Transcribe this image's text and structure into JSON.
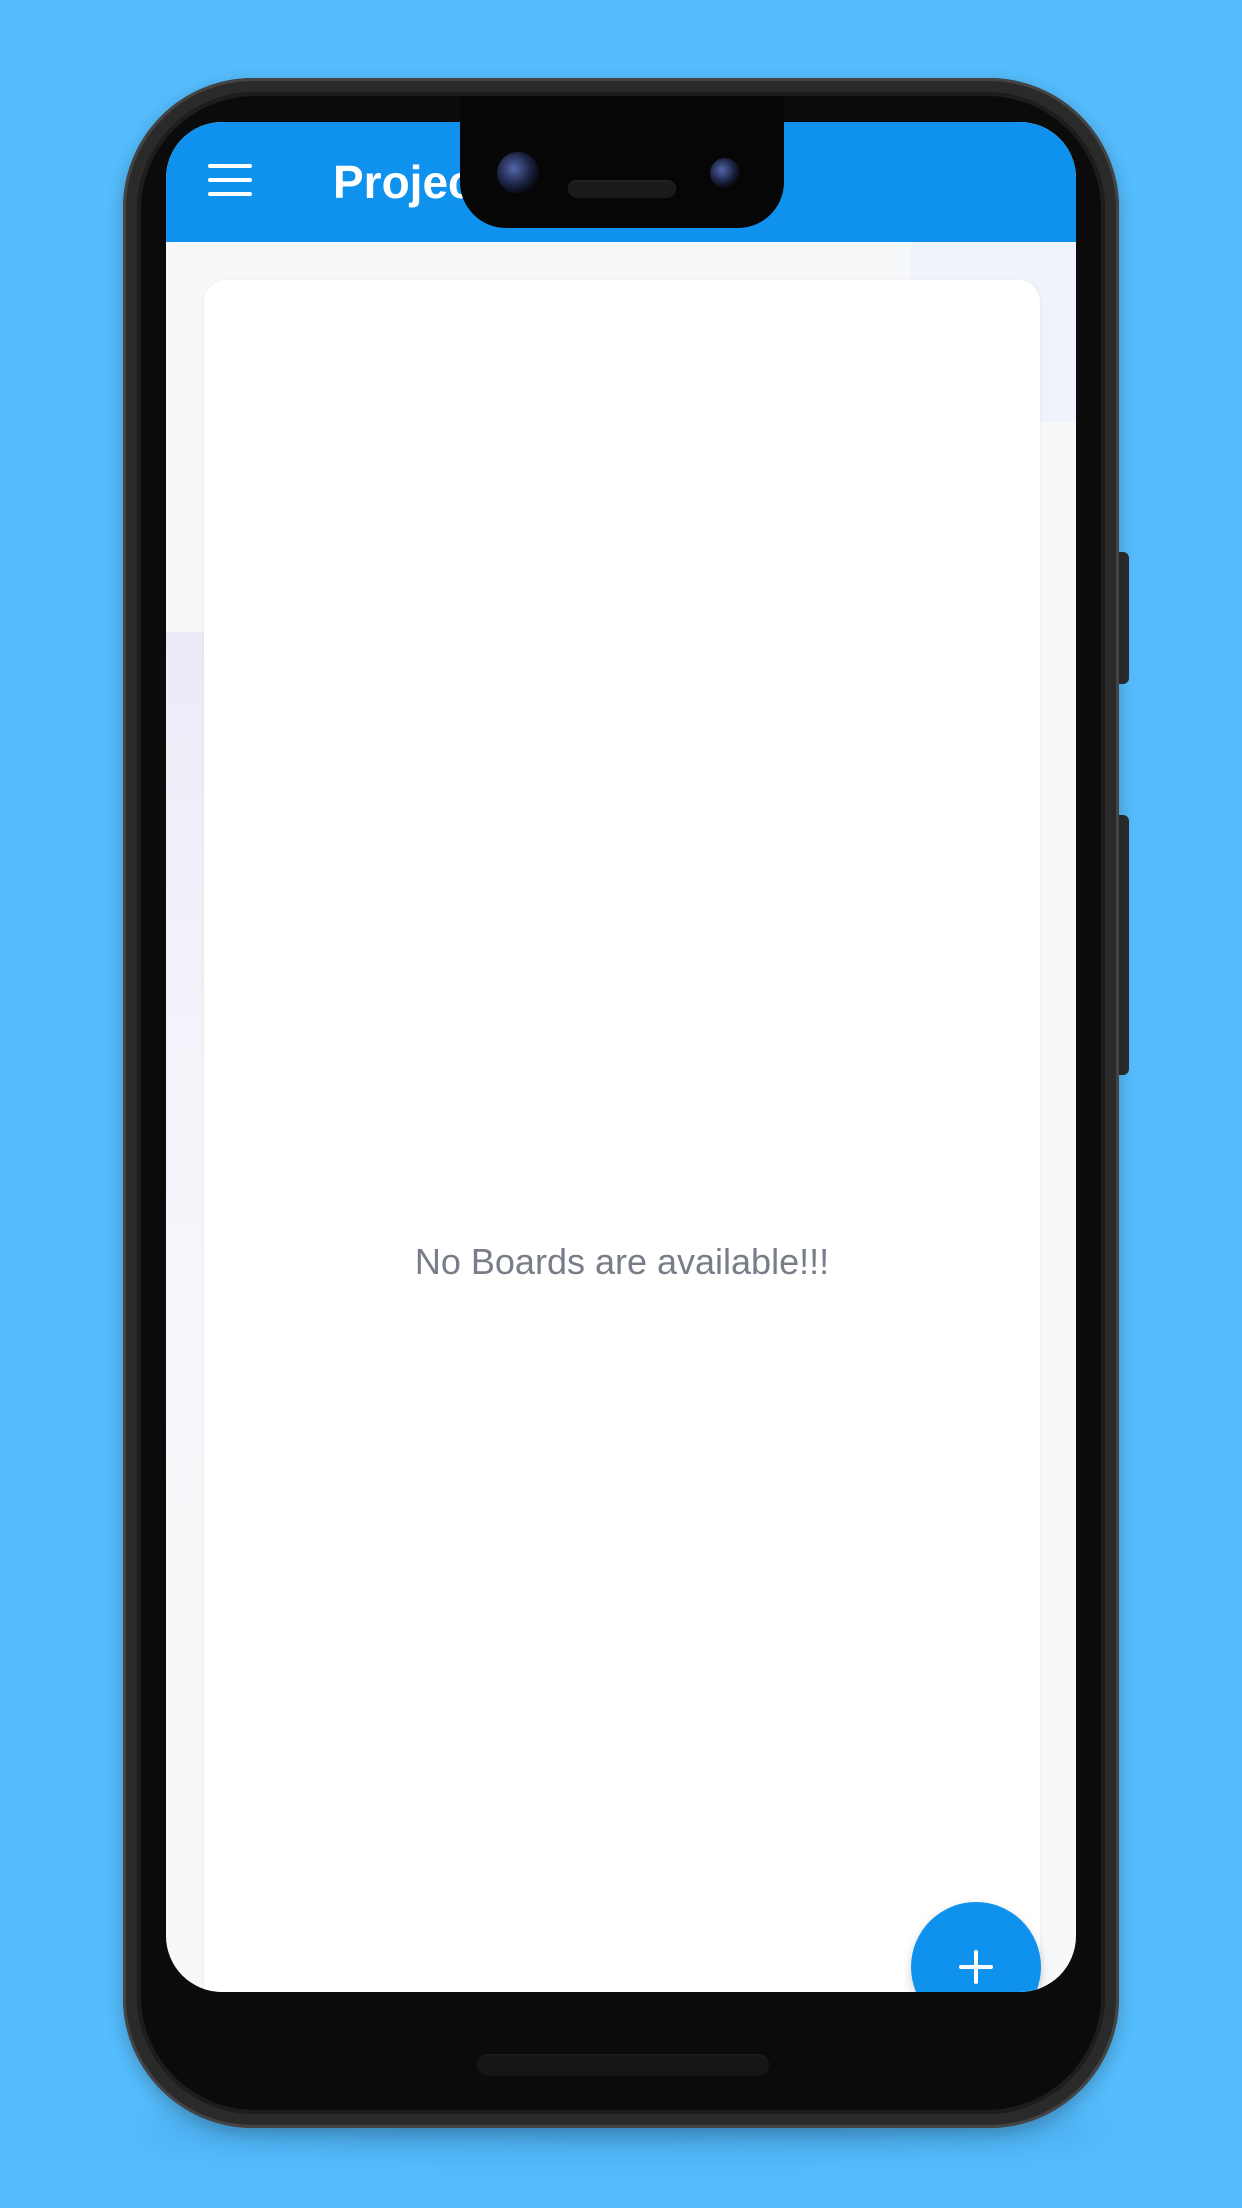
{
  "app_bar": {
    "title": "Projec",
    "menu_icon": "menu-icon",
    "color": "#0F91EE"
  },
  "main": {
    "empty_state": "No Boards are available!!!"
  },
  "fab": {
    "icon": "add-icon",
    "color": "#0F91EE"
  },
  "colors": {
    "background": "#55BDFD",
    "accent": "#0F91EE",
    "card": "#FFFFFF",
    "muted_text": "#787D89"
  }
}
